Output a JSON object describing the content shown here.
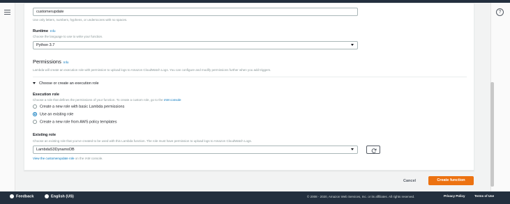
{
  "function_name": {
    "value": "customerupdate",
    "hint": "Use only letters, numbers, hyphens, or underscores with no spaces."
  },
  "runtime": {
    "label": "Runtime",
    "info": "Info",
    "hint": "Choose the language to use to write your function.",
    "value": "Python 3.7"
  },
  "permissions": {
    "title": "Permissions",
    "info": "Info",
    "description": "Lambda will create an execution role with permission to upload logs to Amazon CloudWatch Logs. You can configure and modify permissions further when you add triggers.",
    "expander_label": "Choose or create an execution role"
  },
  "execution_role": {
    "label": "Execution role",
    "hint_prefix": "Choose a role that defines the permissions of your function. To create a custom role, go to the",
    "hint_link": "IAM console",
    "options": [
      {
        "label": "Create a new role with basic Lambda permissions",
        "checked": false
      },
      {
        "label": "Use an existing role",
        "checked": true
      },
      {
        "label": "Create a new role from AWS policy templates",
        "checked": false
      }
    ]
  },
  "existing_role": {
    "label": "Existing role",
    "hint": "Choose an existing role that you've created to be used with this Lambda function. The role must have permission to upload logs to Amazon CloudWatch Logs.",
    "value": "LambdaS3DynamoDB",
    "view_link": "View the customerupdate role",
    "view_suffix": "on the IAM console."
  },
  "actions": {
    "cancel": "Cancel",
    "create": "Create function"
  },
  "footer": {
    "feedback": "Feedback",
    "language": "English (US)",
    "copyright": "© 2008 - 2020, Amazon Web Services, Inc. or its affiliates. All rights reserved.",
    "privacy": "Privacy Policy",
    "terms": "Terms of Use"
  },
  "colors": {
    "primary_button": "#ec7211",
    "link": "#0073bb",
    "footer_bg": "#232f3e"
  }
}
